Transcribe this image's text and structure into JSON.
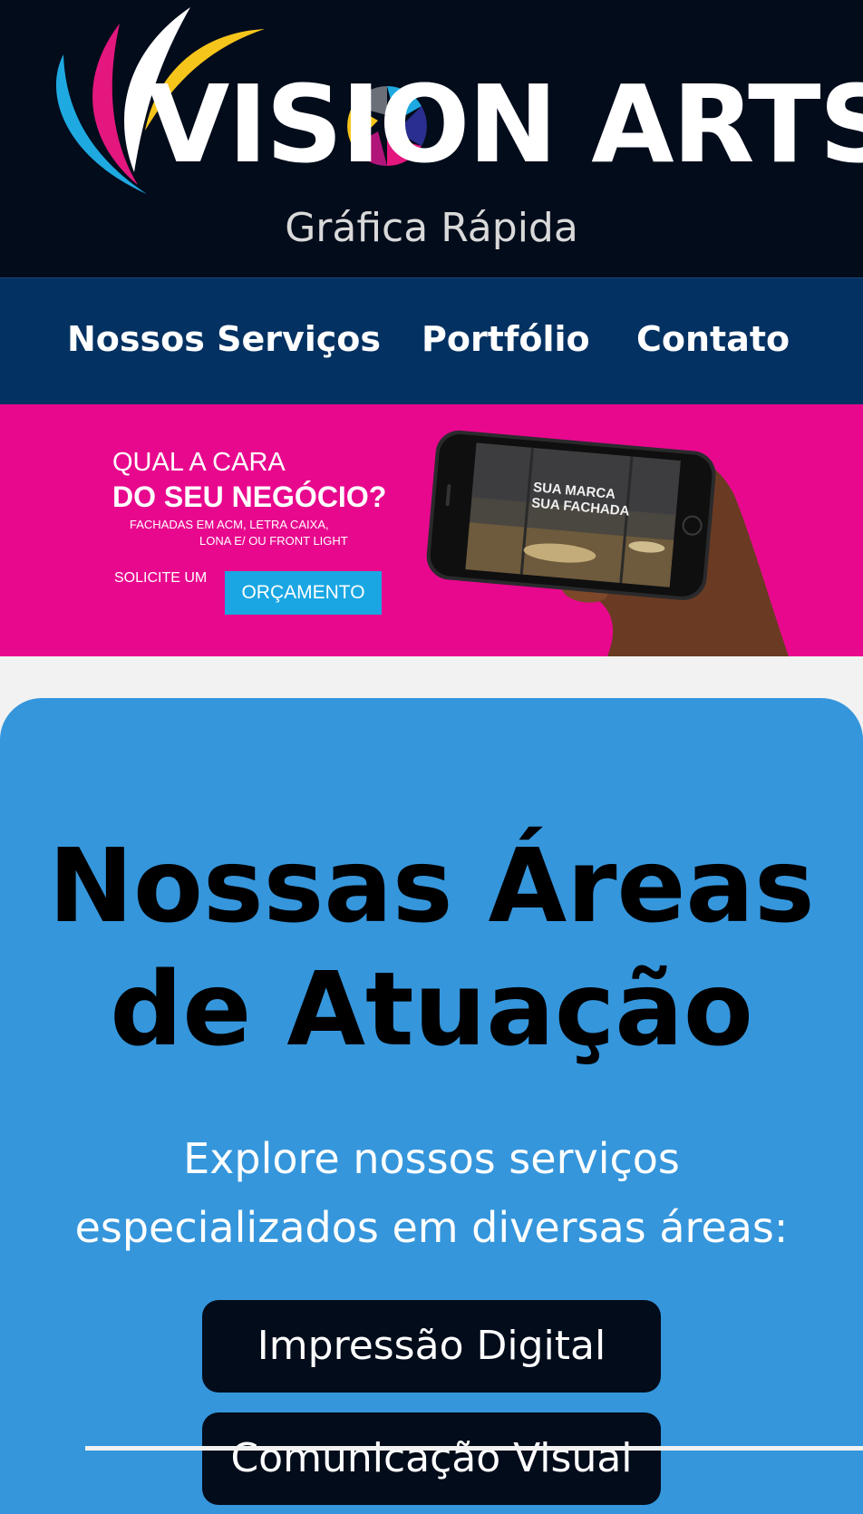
{
  "header": {
    "logo_text": "VISION ARTS",
    "tagline": "Gráfica Rápida"
  },
  "nav": {
    "items": [
      "Nossos Serviços",
      "Portfólio",
      "Contato"
    ]
  },
  "banner": {
    "line1": "QUAL A CARA",
    "line2": "DO SEU NEGÓCIO?",
    "line3": "FACHADAS EM ACM, LETRA CAIXA,",
    "line4": "LONA E/ OU FRONT LIGHT",
    "cta_prefix": "SOLICITE UM",
    "cta_label": "ORÇAMENTO",
    "phone_text1": "SUA MARCA",
    "phone_text2": "SUA FACHADA"
  },
  "services": {
    "title_line1": "Nossas Áreas",
    "title_line2": "de Atuação",
    "subtitle_line1": "Explore nossos serviços",
    "subtitle_line2": "especializados em diversas áreas:",
    "buttons": [
      "Impressão Digital",
      "Comunicação Visual"
    ]
  },
  "colors": {
    "header_bg": "#030c1b",
    "nav_bg": "#033162",
    "banner_bg": "#e8088e",
    "cta_bg": "#19a6e3",
    "section_bg": "#3596dc",
    "logo_cyan": "#1fa9e1",
    "logo_magenta": "#e3177e",
    "logo_yellow": "#f6c51b"
  },
  "icons": [
    "logo-swoosh-icon",
    "camera-aperture-icon",
    "smartphone-icon",
    "hand-icon"
  ]
}
